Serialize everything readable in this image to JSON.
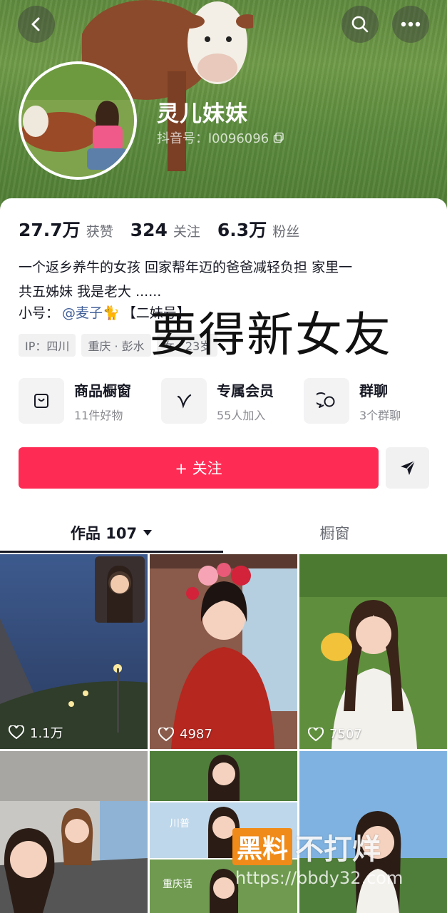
{
  "profile": {
    "name": "灵儿妹妹",
    "douyin_id": "抖音号：l0096096"
  },
  "stats": [
    {
      "num": "27.7万",
      "label": "获赞"
    },
    {
      "num": "324",
      "label": "关注"
    },
    {
      "num": "6.3万",
      "label": "粉丝"
    }
  ],
  "bio": {
    "line1": "一个返乡养牛的女孩 回家帮年迈的爸爸减轻负担  家里一",
    "line2": "共五姊妹 我是老大 ......",
    "alt_prefix": "小号：",
    "alt_link": "@麦子🐈",
    "alt_suffix": "【二妹号】"
  },
  "tags": [
    "IP：四川",
    "重庆 · 彭水",
    "女 · 23岁"
  ],
  "overlay_caption": "要得新女友",
  "features": [
    {
      "title": "商品橱窗",
      "sub": "11件好物",
      "icon": "shop-bag-icon"
    },
    {
      "title": "专属会员",
      "sub": "55人加入",
      "icon": "v-badge-icon"
    },
    {
      "title": "群聊",
      "sub": "3个群聊",
      "icon": "chat-bubbles-icon"
    }
  ],
  "follow_label": "+ 关注",
  "tabs": {
    "works": "作品 107",
    "showcase": "橱窗"
  },
  "videos": [
    {
      "likes": "1.1万"
    },
    {
      "likes": "4987"
    },
    {
      "likes": "7507"
    }
  ],
  "video_overlay_text": {
    "a": "川普",
    "b": "重庆话"
  },
  "watermark": {
    "box": "黑料",
    "text": "不打烊",
    "url": "https://bbdy32.com"
  },
  "colors": {
    "accent": "#fe2c55",
    "link": "#3f5e98"
  }
}
